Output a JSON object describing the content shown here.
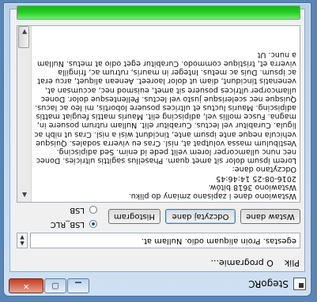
{
  "window": {
    "title": "StegoRC",
    "minimize_glyph": "▁",
    "maximize_glyph": "▢",
    "close_glyph": "✕"
  },
  "menu": {
    "items": [
      "Plik",
      "O programie..."
    ]
  },
  "path_field": {
    "value": "egestas. Proin aliquam odio. Nullam at."
  },
  "buttons": {
    "open_label": "Wstaw dane",
    "read_label": "Odczytaj dane",
    "histogram_label": "Histogram"
  },
  "mode": {
    "options": [
      "LSB_RLC",
      "LSB"
    ],
    "selected": "LSB_RLC"
  },
  "log": {
    "text": "Wstawiono dane i zapisano zmiany do pliku.\nWstawiono 3618 bitów.\n2016-08-25 14:46:45\nOdczytano dane:\nLorem ipsum dolor sit amet quam. Phasellus sagittis ultricies. Donec nec nunc ullamcorper lorem velit pede id enim. Sed adipiscing. Vestibulum massa volutpat at, nisl. Cras eu viverra sodales. Quisque vehicula neque ante ipsum ante, tincidunt wisi a nisl. Cras ut nibh ac ligula. Curabitur vel lectus. Curabitur elit. Nullam rutrum posuere in, magna. Fusce mollis vel, adipiscing elit. Mauris mattis feugiat mattis adipiscing. Mauris luctus et ultrices posuere lobortis, mi leo ac lacus. Quisque nec scelerisque justo vel lectus. Pellentesque dolor. Donec ullamcorper ultrices posuere sit amet, euismod nec, accumsan at, venenatis tincidunt, diam ut dolor laoreet. Aenean aliquet, arcu erat ac ipsum. Duis ac metus. Integer in mauris, rutrum ac, fringilla viverra et, tristique commodo. Curabitur eget odio at metus. Nullam a nunc. Ut"
  },
  "progress": {
    "fraction": 1.0,
    "color": "#1fcb1f"
  }
}
